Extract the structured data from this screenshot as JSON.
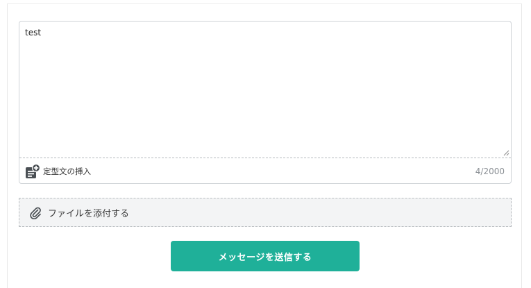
{
  "composer": {
    "message_value": "test",
    "template_insert_label": "定型文の挿入",
    "char_count": "4/2000"
  },
  "attachment": {
    "label": "ファイルを添付する"
  },
  "actions": {
    "send_label": "メッセージを送信する"
  },
  "colors": {
    "accent": "#1fb099",
    "icon_dark": "#4a4f54"
  },
  "icons": {
    "template": "document-plus-icon",
    "attach": "paperclip-icon"
  }
}
